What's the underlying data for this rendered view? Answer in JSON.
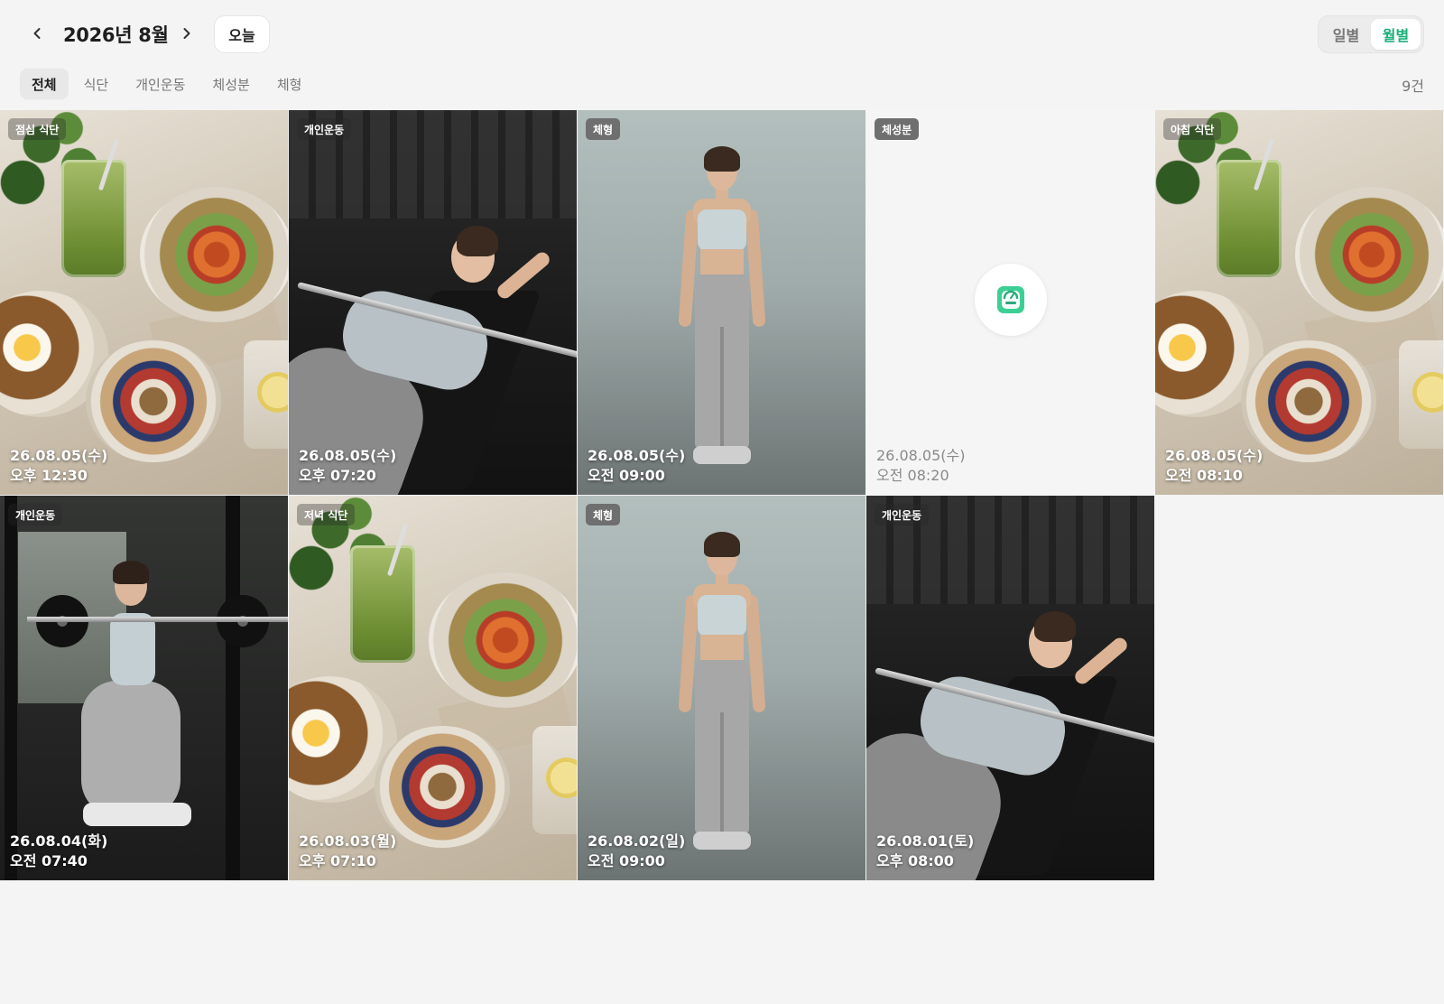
{
  "header": {
    "month_title": "2026년 8월",
    "today_label": "오늘",
    "view_options": [
      "일별",
      "월별"
    ],
    "active_view": "월별"
  },
  "tabs": [
    "전체",
    "식단",
    "개인운동",
    "체성분",
    "체형"
  ],
  "active_tab": "전체",
  "count": "9건",
  "colors": {
    "accent": "#1db07a",
    "tag_solid": "#6f6f6f"
  },
  "records": [
    {
      "tag": "점심 식단",
      "date": "26.08.05(수)",
      "time": "오후 12:30",
      "kind": "meal"
    },
    {
      "tag": "개인운동",
      "date": "26.08.05(수)",
      "time": "오후 07:20",
      "kind": "bench-press"
    },
    {
      "tag": "체형",
      "date": "26.08.05(수)",
      "time": "오전 09:00",
      "kind": "body-shape"
    },
    {
      "tag": "체성분",
      "date": "26.08.05(수)",
      "time": "오전 08:20",
      "kind": "scale",
      "icon": "scale-icon"
    },
    {
      "tag": "아침 식단",
      "date": "26.08.05(수)",
      "time": "오전 08:10",
      "kind": "meal"
    },
    {
      "tag": "개인운동",
      "date": "26.08.04(화)",
      "time": "오전 07:40",
      "kind": "squat"
    },
    {
      "tag": "저녁 식단",
      "date": "26.08.03(월)",
      "time": "오후 07:10",
      "kind": "meal"
    },
    {
      "tag": "체형",
      "date": "26.08.02(일)",
      "time": "오전 09:00",
      "kind": "body-shape"
    },
    {
      "tag": "개인운동",
      "date": "26.08.01(토)",
      "time": "오후 08:00",
      "kind": "bench-press"
    }
  ]
}
